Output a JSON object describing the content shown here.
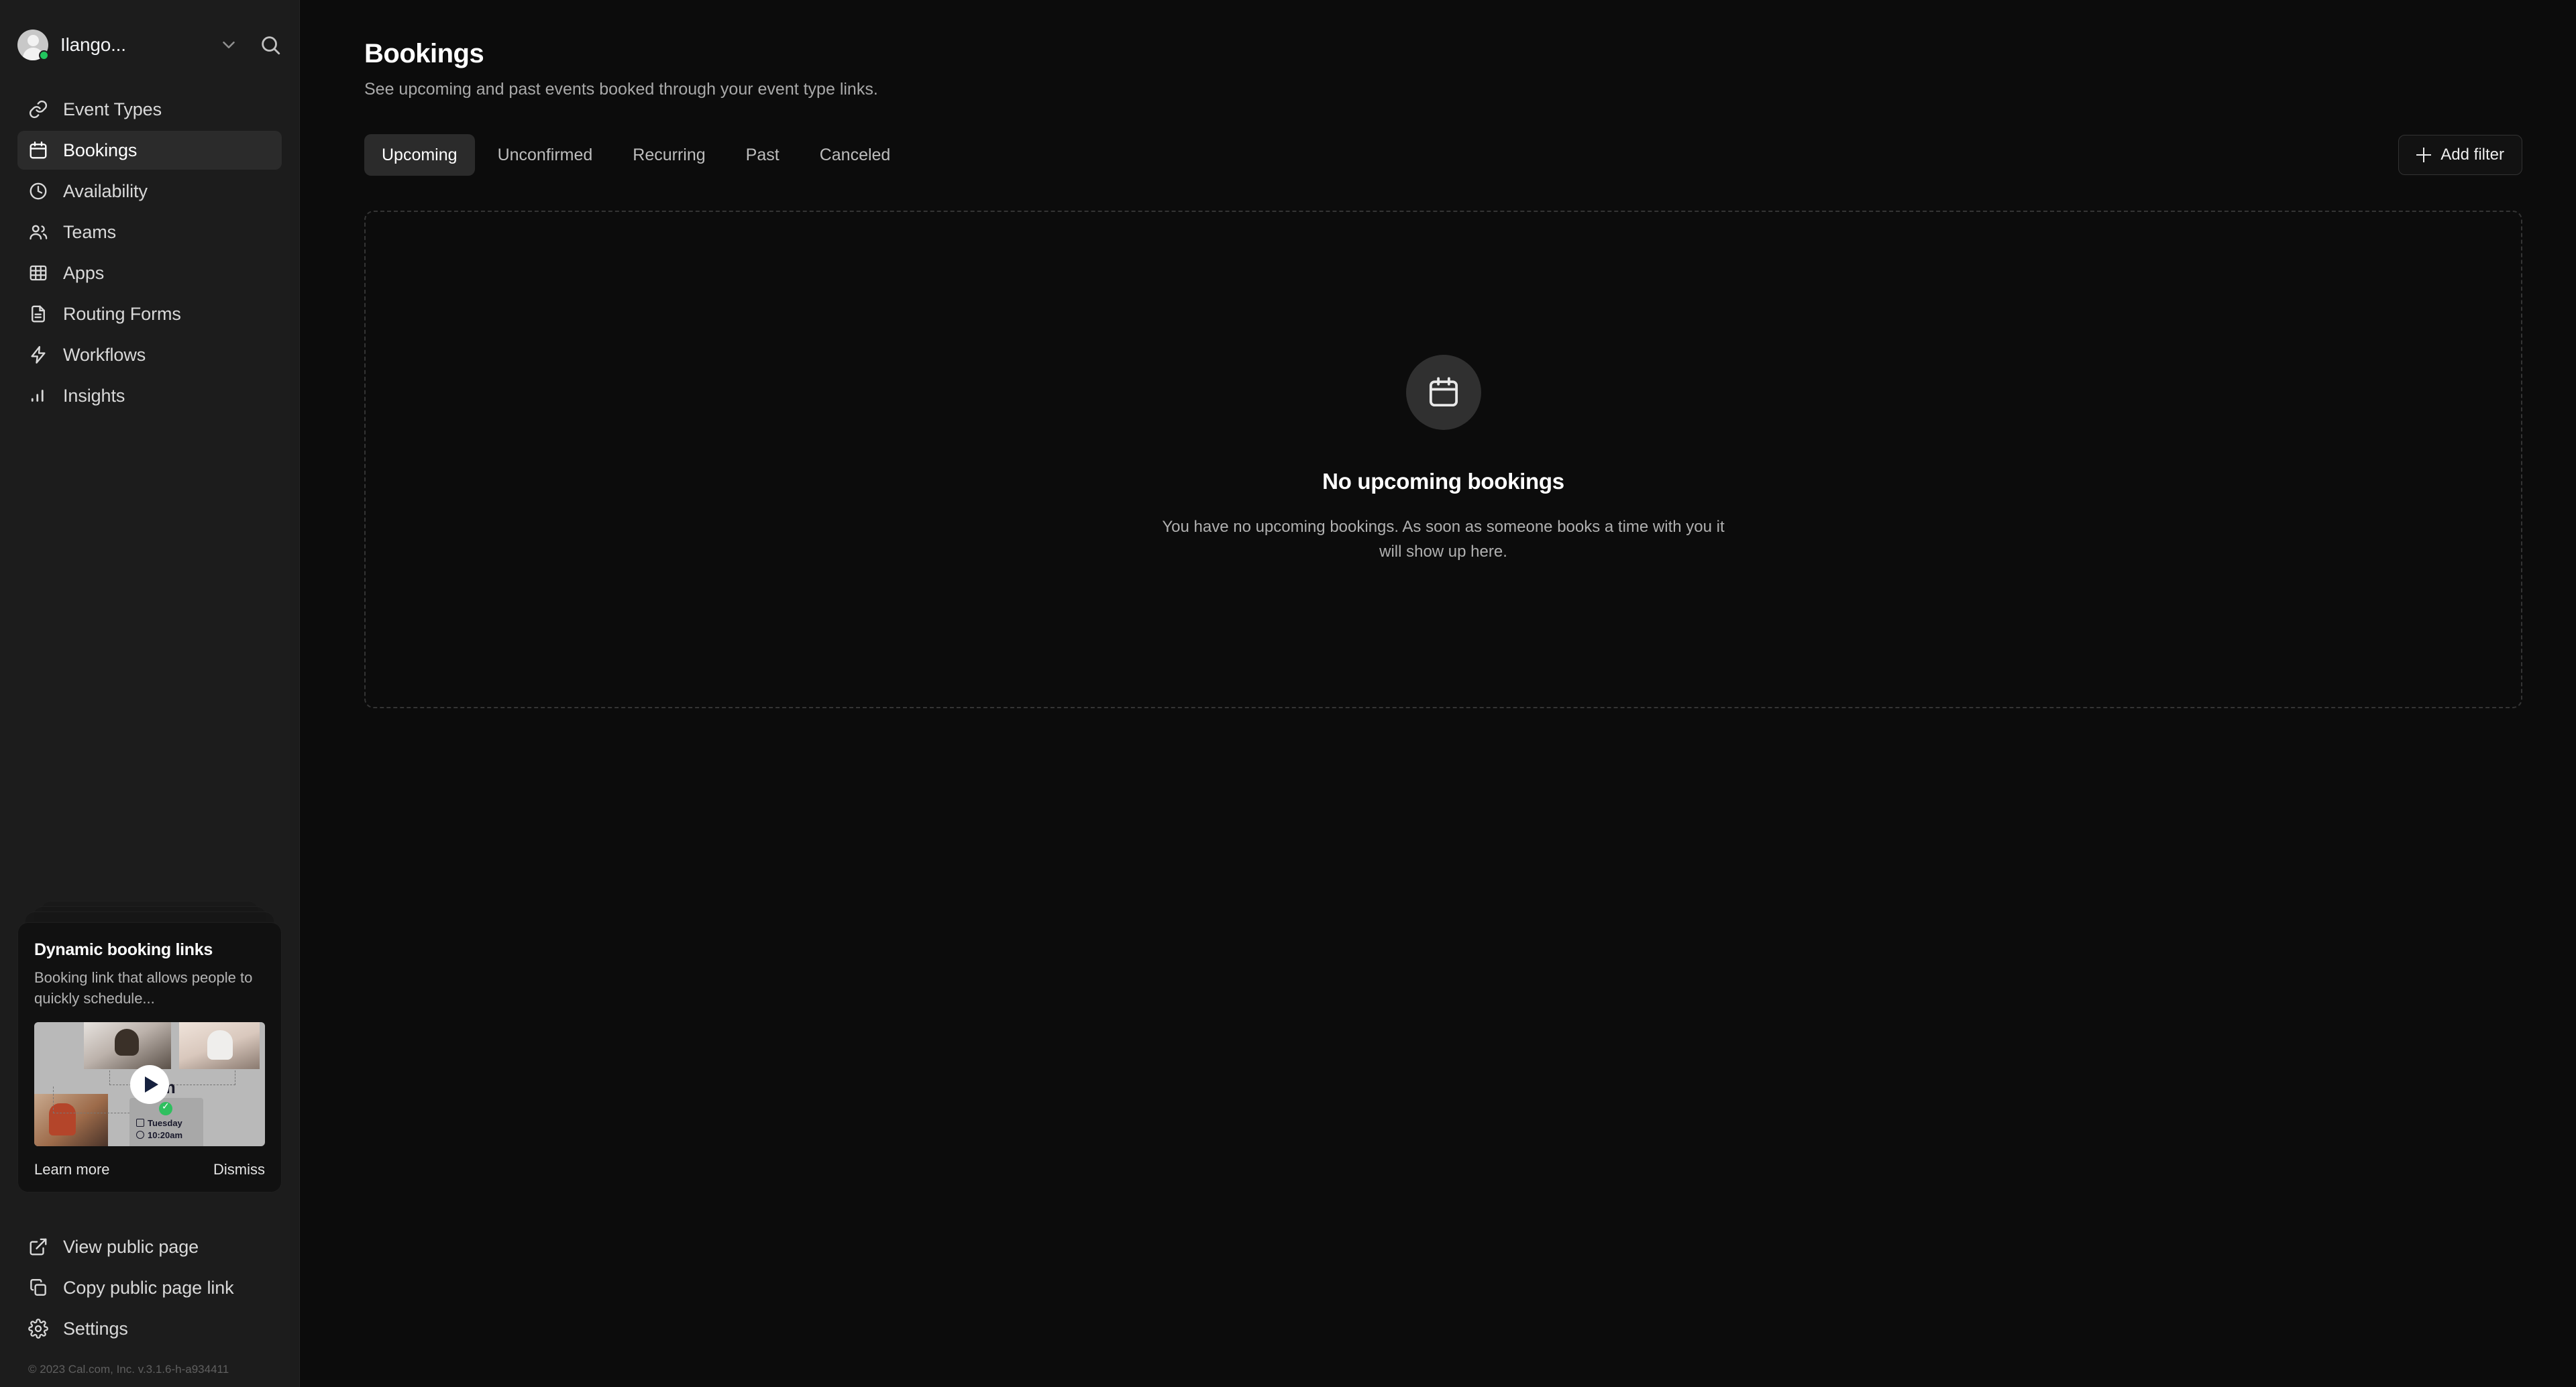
{
  "sidebar": {
    "user": {
      "name": "Ilango...",
      "status": "online"
    },
    "search_label": "Search",
    "nav_items": [
      {
        "label": "Event Types",
        "icon": "link-icon",
        "active": false
      },
      {
        "label": "Bookings",
        "icon": "calendar-icon",
        "active": true
      },
      {
        "label": "Availability",
        "icon": "clock-icon",
        "active": false
      },
      {
        "label": "Teams",
        "icon": "users-icon",
        "active": false
      },
      {
        "label": "Apps",
        "icon": "grid-icon",
        "active": false
      },
      {
        "label": "Routing Forms",
        "icon": "document-icon",
        "active": false
      },
      {
        "label": "Workflows",
        "icon": "bolt-icon",
        "active": false
      },
      {
        "label": "Insights",
        "icon": "bar-chart-icon",
        "active": false
      }
    ],
    "promo": {
      "title": "Dynamic booking links",
      "description": "Booking link that allows people to quickly schedule...",
      "thumbnail_domain": ".com",
      "thumbnail_day": "Tuesday",
      "thumbnail_time": "10:20am",
      "learn_more": "Learn more",
      "dismiss": "Dismiss"
    },
    "bottom_items": [
      {
        "label": "View public page",
        "icon": "external-link-icon"
      },
      {
        "label": "Copy public page link",
        "icon": "copy-icon"
      },
      {
        "label": "Settings",
        "icon": "gear-icon"
      }
    ],
    "footer": "© 2023 Cal.com, Inc. v.3.1.6-h-a934411"
  },
  "main": {
    "title": "Bookings",
    "subtitle": "See upcoming and past events booked through your event type links.",
    "tabs": [
      {
        "label": "Upcoming",
        "active": true
      },
      {
        "label": "Unconfirmed",
        "active": false
      },
      {
        "label": "Recurring",
        "active": false
      },
      {
        "label": "Past",
        "active": false
      },
      {
        "label": "Canceled",
        "active": false
      }
    ],
    "add_filter_label": "Add filter",
    "empty_state": {
      "icon": "calendar-icon",
      "title": "No upcoming bookings",
      "description": "You have no upcoming bookings. As soon as someone books a time with you it will show up here."
    }
  },
  "colors": {
    "sidebar_bg": "#1c1c1c",
    "main_bg": "#0c0c0c",
    "active_bg": "#2b2b2b",
    "status_green": "#22c55e",
    "text_primary": "#ffffff",
    "text_secondary": "#a9a9a9"
  }
}
